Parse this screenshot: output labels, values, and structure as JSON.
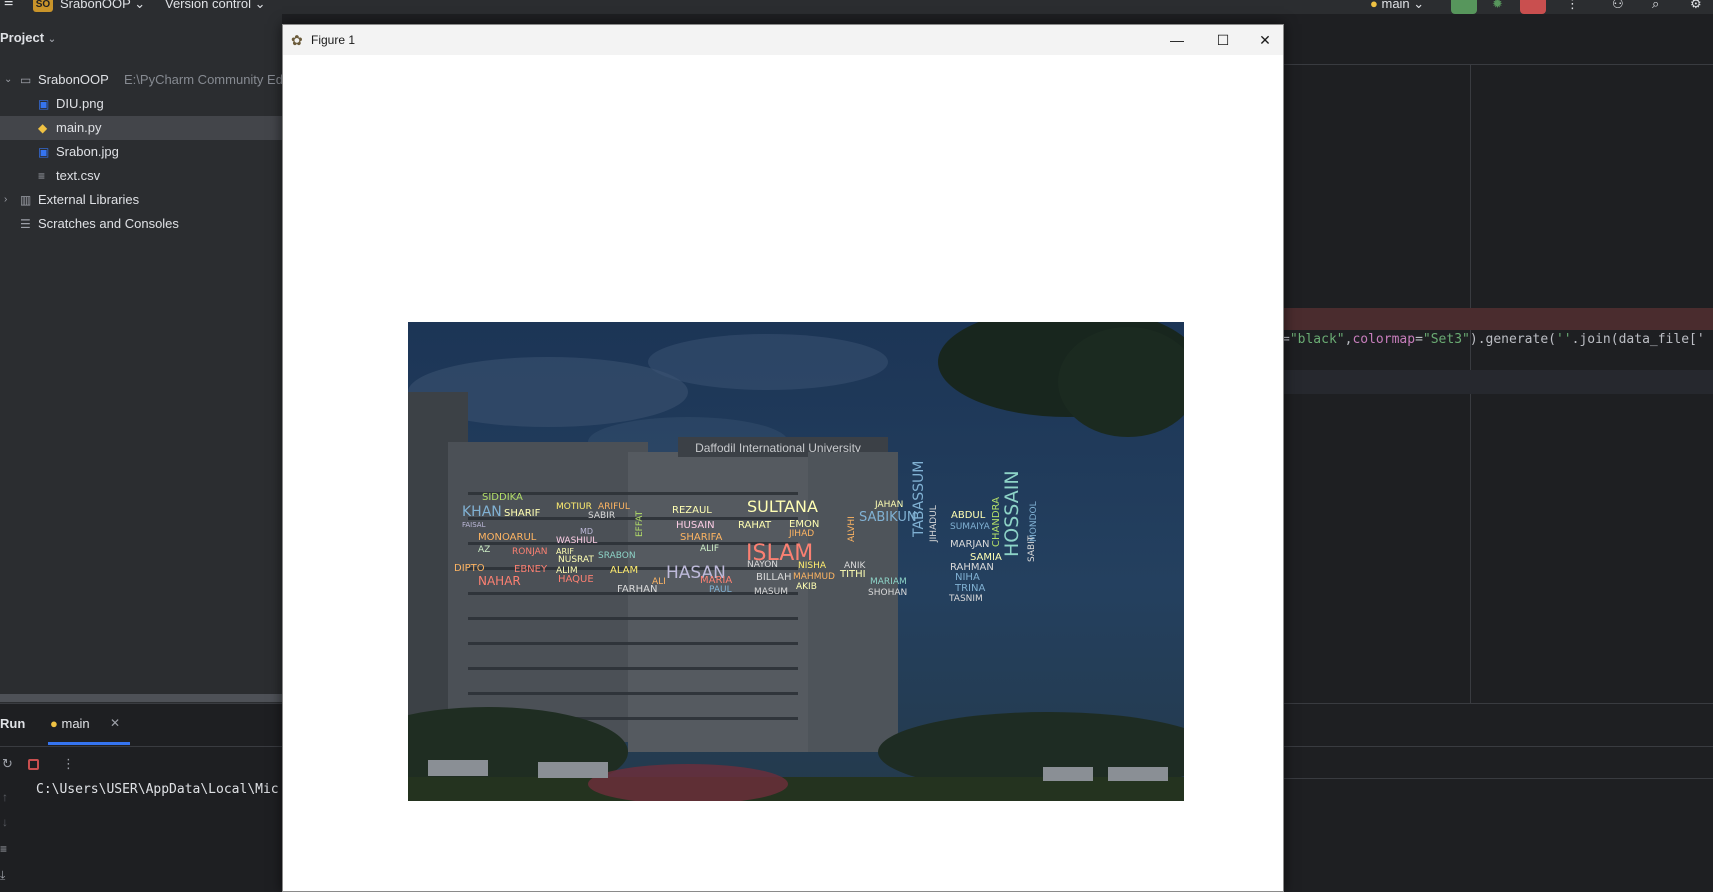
{
  "topbar": {
    "project_badge": "SO",
    "project_name": "SrabonOOP",
    "version_control": "Version control",
    "run_config": "main"
  },
  "project_panel": {
    "title": "Project",
    "tree": [
      {
        "label": "SrabonOOP",
        "sub": "E:\\PyCharm Community Ed",
        "icon": "folder-icon"
      },
      {
        "label": "DIU.png",
        "icon": "image-file-icon"
      },
      {
        "label": "main.py",
        "icon": "python-file-icon"
      },
      {
        "label": "Srabon.jpg",
        "icon": "image-file-icon"
      },
      {
        "label": "text.csv",
        "icon": "text-file-icon"
      },
      {
        "label": "External Libraries",
        "icon": "library-icon"
      },
      {
        "label": "Scratches and Consoles",
        "icon": "scratches-icon"
      }
    ]
  },
  "run_panel": {
    "title": "Run",
    "tab": "main",
    "console_text": "C:\\Users\\USER\\AppData\\Local\\Mic"
  },
  "editor": {
    "code_parts": [
      {
        "text": "=",
        "color": "#bcbec4"
      },
      {
        "text": "\"black\"",
        "color": "#6aab73"
      },
      {
        "text": ",",
        "color": "#bcbec4"
      },
      {
        "text": "colormap",
        "color": "#c77dbb"
      },
      {
        "text": "=",
        "color": "#bcbec4"
      },
      {
        "text": "\"Set3\"",
        "color": "#6aab73"
      },
      {
        "text": ").generate(",
        "color": "#bcbec4"
      },
      {
        "text": "''",
        "color": "#6aab73"
      },
      {
        "text": ".join(data_file['",
        "color": "#bcbec4"
      }
    ]
  },
  "figure": {
    "title": "Figure 1",
    "banner": "Daffodil International University",
    "wordcloud": [
      {
        "w": "SIDDIKA",
        "c": "#b3de69"
      },
      {
        "w": "KHAN",
        "c": "#80b1d3"
      },
      {
        "w": "SHARIF",
        "c": "#ffffb3"
      },
      {
        "w": "FAISAL",
        "c": "#bebada"
      },
      {
        "w": "MONOARUL",
        "c": "#fdb462"
      },
      {
        "w": "AZ",
        "c": "#ccebc5"
      },
      {
        "w": "RONJAN",
        "c": "#fb8072"
      },
      {
        "w": "DIPTO",
        "c": "#fdb462"
      },
      {
        "w": "EBNEY",
        "c": "#fb8072"
      },
      {
        "w": "NAHAR",
        "c": "#fb8072"
      },
      {
        "w": "MOTIUR",
        "c": "#ffed6f"
      },
      {
        "w": "SABIR",
        "c": "#d9d9d9"
      },
      {
        "w": "ARIFUL",
        "c": "#fdb462"
      },
      {
        "w": "MD",
        "c": "#bebada"
      },
      {
        "w": "WASHIUL",
        "c": "#fccde5"
      },
      {
        "w": "ARIF",
        "c": "#ffffb3"
      },
      {
        "w": "NUSRAT",
        "c": "#ffffb3"
      },
      {
        "w": "SRABON",
        "c": "#8dd3c7"
      },
      {
        "w": "ALIM",
        "c": "#ffffb3"
      },
      {
        "w": "HAQUE",
        "c": "#fb8072"
      },
      {
        "w": "EFFAT",
        "c": "#b3de69"
      },
      {
        "w": "ALAM",
        "c": "#ffed6f"
      },
      {
        "w": "FARHAN",
        "c": "#d9d9d9"
      },
      {
        "w": "ALI",
        "c": "#fdb462"
      },
      {
        "w": "REZAUL",
        "c": "#ffffb3"
      },
      {
        "w": "HUSAIN",
        "c": "#fccde5"
      },
      {
        "w": "SHARIFA",
        "c": "#fdb462"
      },
      {
        "w": "ALIF",
        "c": "#ccebc5"
      },
      {
        "w": "HASAN",
        "c": "#bebada"
      },
      {
        "w": "MARIA",
        "c": "#fb8072"
      },
      {
        "w": "PAUL",
        "c": "#80b1d3"
      },
      {
        "w": "SULTANA",
        "c": "#ffffb3"
      },
      {
        "w": "RAHAT",
        "c": "#ffffb3"
      },
      {
        "w": "EMON",
        "c": "#ffffb3"
      },
      {
        "w": "JIHAD",
        "c": "#fdb462"
      },
      {
        "w": "ISLAM",
        "c": "#fb8072"
      },
      {
        "w": "NAYON",
        "c": "#d9d9d9"
      },
      {
        "w": "NISHA",
        "c": "#ffed6f"
      },
      {
        "w": "BILLAH",
        "c": "#d9d9d9"
      },
      {
        "w": "MAHMUD",
        "c": "#fdb462"
      },
      {
        "w": "AKIB",
        "c": "#ffffb3"
      },
      {
        "w": "MASUM",
        "c": "#d9d9d9"
      },
      {
        "w": "SABIKUN",
        "c": "#80b1d3"
      },
      {
        "w": "JAHAN",
        "c": "#ffffb3"
      },
      {
        "w": "ALVHI",
        "c": "#fdb462"
      },
      {
        "w": "ANIK",
        "c": "#d9d9d9"
      },
      {
        "w": "TITHI",
        "c": "#ffffb3"
      },
      {
        "w": "MARIAM",
        "c": "#8dd3c7"
      },
      {
        "w": "SHOHAN",
        "c": "#d9d9d9"
      },
      {
        "w": "TABASSUM",
        "c": "#80b1d3"
      },
      {
        "w": "ABDUL",
        "c": "#ffffb3"
      },
      {
        "w": "SUMAIYA",
        "c": "#80b1d3"
      },
      {
        "w": "MARJAN",
        "c": "#d9d9d9"
      },
      {
        "w": "SAMIA",
        "c": "#ffffb3"
      },
      {
        "w": "RAHMAN",
        "c": "#d9d9d9"
      },
      {
        "w": "NIHA",
        "c": "#80b1d3"
      },
      {
        "w": "TRINA",
        "c": "#80b1d3"
      },
      {
        "w": "TASNIM",
        "c": "#d9d9d9"
      },
      {
        "w": "CHANDRA",
        "c": "#b3de69"
      },
      {
        "w": "HOSSAIN",
        "c": "#8dd3c7"
      },
      {
        "w": "SABIT",
        "c": "#d9d9d9"
      },
      {
        "w": "MONDOL",
        "c": "#80b1d3"
      },
      {
        "w": "JIHADUL",
        "c": "#d9d9d9"
      }
    ]
  }
}
